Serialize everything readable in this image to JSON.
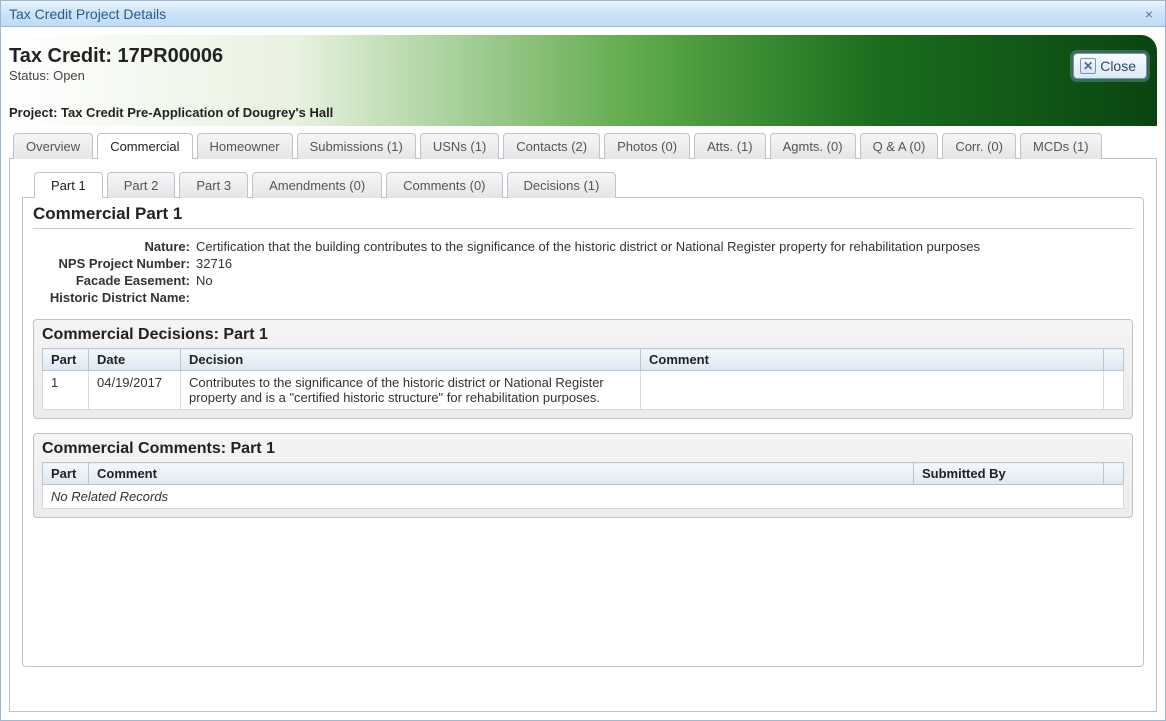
{
  "window_title": "Tax Credit Project Details",
  "header": {
    "title": "Tax Credit: 17PR00006",
    "status": "Status: Open",
    "project": "Project: Tax Credit Pre-Application of Dougrey's Hall",
    "close_label": "Close"
  },
  "main_tabs": [
    {
      "label": "Overview"
    },
    {
      "label": "Commercial"
    },
    {
      "label": "Homeowner"
    },
    {
      "label": "Submissions (1)"
    },
    {
      "label": "USNs (1)"
    },
    {
      "label": "Contacts (2)"
    },
    {
      "label": "Photos (0)"
    },
    {
      "label": "Atts. (1)"
    },
    {
      "label": "Agmts. (0)"
    },
    {
      "label": "Q & A (0)"
    },
    {
      "label": "Corr. (0)"
    },
    {
      "label": "MCDs (1)"
    }
  ],
  "sub_tabs": [
    {
      "label": "Part 1"
    },
    {
      "label": "Part 2"
    },
    {
      "label": "Part 3"
    },
    {
      "label": "Amendments (0)"
    },
    {
      "label": "Comments (0)"
    },
    {
      "label": "Decisions (1)"
    }
  ],
  "section_title": "Commercial Part 1",
  "fields": {
    "nature": {
      "label": "Nature:",
      "value": "Certification that the building contributes to the significance of the historic district or National Register property for rehabilitation purposes"
    },
    "nps": {
      "label": "NPS Project Number:",
      "value": "32716"
    },
    "facade": {
      "label": "Facade Easement:",
      "value": "No"
    },
    "district": {
      "label": "Historic District Name:",
      "value": ""
    }
  },
  "decisions": {
    "title": "Commercial Decisions: Part 1",
    "headers": {
      "part": "Part",
      "date": "Date",
      "decision": "Decision",
      "comment": "Comment"
    },
    "rows": [
      {
        "part": "1",
        "date": "04/19/2017",
        "decision": "Contributes to the significance of the historic district or National Register property and is a \"certified historic structure\" for rehabilitation purposes.",
        "comment": ""
      }
    ]
  },
  "comments": {
    "title": "Commercial Comments: Part 1",
    "headers": {
      "part": "Part",
      "comment": "Comment",
      "submitted_by": "Submitted By"
    },
    "no_records": "No Related Records"
  }
}
